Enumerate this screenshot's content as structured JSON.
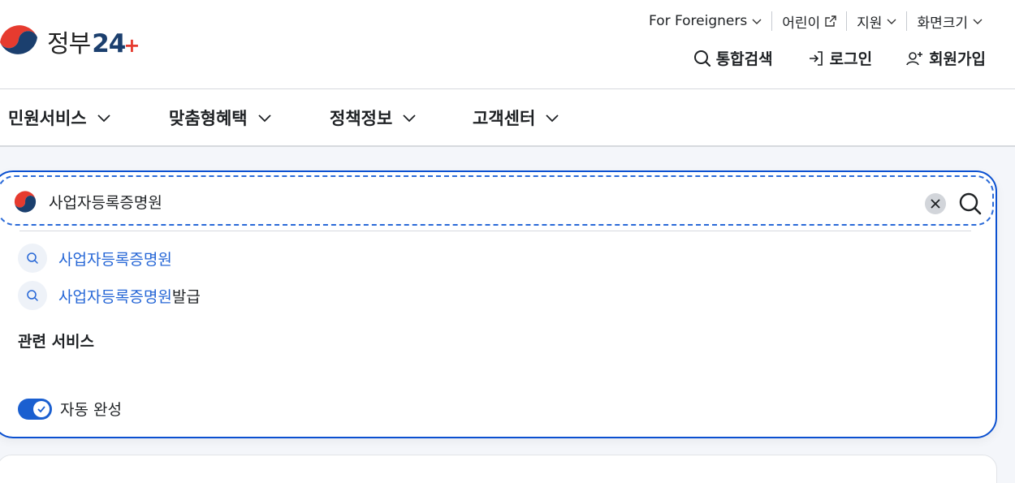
{
  "logo": {
    "text_ko": "정부",
    "text_num": "24",
    "text_plus": "+"
  },
  "utility": {
    "foreigners": "For Foreigners",
    "kids": "어린이",
    "support": "지원",
    "screen_size": "화면크기"
  },
  "actions": {
    "search": "통합검색",
    "login": "로그인",
    "signup": "회원가입"
  },
  "nav": {
    "items": [
      {
        "label": "민원서비스"
      },
      {
        "label": "맞춤형혜택"
      },
      {
        "label": "정책정보"
      },
      {
        "label": "고객센터"
      }
    ]
  },
  "search": {
    "value": "사업자등록증명원",
    "suggestions": [
      {
        "highlight": "사업자등록증명원",
        "rest": ""
      },
      {
        "highlight": "사업자등록증명원",
        "rest": "발급"
      }
    ],
    "related_title": "관련 서비스",
    "autocomplete_label": "자동 완성",
    "autocomplete_on": true
  },
  "colors": {
    "accent": "#0b50d0",
    "highlight_text": "#2566d6",
    "logo_navy": "#1b3f6e",
    "logo_red": "#e63b2f"
  }
}
